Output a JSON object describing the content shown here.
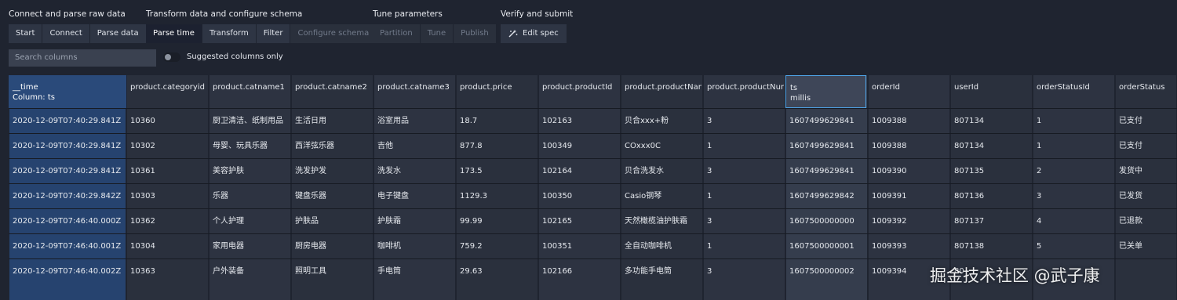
{
  "stages": [
    {
      "title": "Connect and parse raw data",
      "buttons": [
        {
          "label": "Start",
          "state": "normal"
        },
        {
          "label": "Connect",
          "state": "normal"
        },
        {
          "label": "Parse data",
          "state": "normal"
        }
      ]
    },
    {
      "title": "Transform data and configure schema",
      "buttons": [
        {
          "label": "Parse time",
          "state": "active"
        },
        {
          "label": "Transform",
          "state": "normal"
        },
        {
          "label": "Filter",
          "state": "normal"
        },
        {
          "label": "Configure schema",
          "state": "disabled"
        }
      ]
    },
    {
      "title": "Tune parameters",
      "buttons": [
        {
          "label": "Partition",
          "state": "disabled"
        },
        {
          "label": "Tune",
          "state": "disabled"
        },
        {
          "label": "Publish",
          "state": "disabled"
        }
      ]
    },
    {
      "title": "Verify and submit",
      "buttons": [
        {
          "label": "Edit spec",
          "state": "edit",
          "icon": "wand-icon"
        }
      ]
    }
  ],
  "search": {
    "placeholder": "Search columns"
  },
  "toggle": {
    "label": "Suggested columns only",
    "on": false
  },
  "columns": [
    {
      "name": "__time",
      "sub": "Column: ts"
    },
    {
      "name": "product.categoryid"
    },
    {
      "name": "product.catname1"
    },
    {
      "name": "product.catname2"
    },
    {
      "name": "product.catname3"
    },
    {
      "name": "product.price"
    },
    {
      "name": "product.productId"
    },
    {
      "name": "product.productNam"
    },
    {
      "name": "product.productNum"
    },
    {
      "name": "ts",
      "sub": "millis"
    },
    {
      "name": "orderId"
    },
    {
      "name": "userId"
    },
    {
      "name": "orderStatusId"
    },
    {
      "name": "orderStatus"
    }
  ],
  "rows": [
    [
      "2020-12-09T07:40:29.841Z",
      "10360",
      "厨卫清洁、纸制用品",
      "生活日用",
      "浴室用品",
      "18.7",
      "102163",
      "贝合xxx+粉",
      "3",
      "1607499629841",
      "1009388",
      "807134",
      "1",
      "已支付"
    ],
    [
      "2020-12-09T07:40:29.841Z",
      "10302",
      "母婴、玩具乐器",
      "西洋弦乐器",
      "吉他",
      "877.8",
      "100349",
      "COxxx0C",
      "1",
      "1607499629841",
      "1009388",
      "807134",
      "1",
      "已支付"
    ],
    [
      "2020-12-09T07:40:29.841Z",
      "10361",
      "美容护肤",
      "洗发护发",
      "洗发水",
      "173.5",
      "102164",
      "贝合洗发水",
      "3",
      "1607499629841",
      "1009390",
      "807135",
      "2",
      "发货中"
    ],
    [
      "2020-12-09T07:40:29.842Z",
      "10303",
      "乐器",
      "键盘乐器",
      "电子键盘",
      "1129.3",
      "100350",
      "Casio钢琴",
      "1",
      "1607499629842",
      "1009391",
      "807136",
      "3",
      "已发货"
    ],
    [
      "2020-12-09T07:46:40.000Z",
      "10362",
      "个人护理",
      "护肤品",
      "护肤霜",
      "99.99",
      "102165",
      "天然橄榄油护肤霜",
      "3",
      "1607500000000",
      "1009392",
      "807137",
      "4",
      "已退款"
    ],
    [
      "2020-12-09T07:46:40.001Z",
      "10304",
      "家用电器",
      "厨房电器",
      "咖啡机",
      "759.2",
      "100351",
      "全自动咖啡机",
      "1",
      "1607500000001",
      "1009393",
      "807138",
      "5",
      "已关单"
    ],
    [
      "2020-12-09T07:46:40.002Z",
      "10363",
      "户外装备",
      "照明工具",
      "手电筒",
      "29.63",
      "102166",
      "多功能手电筒",
      "3",
      "1607500000002",
      "1009394",
      "80",
      "",
      ""
    ]
  ],
  "watermark": "掘金技术社区 @武子康",
  "colors": {
    "background": "#1f2430",
    "time_column": "#2a4a7a",
    "selected_border": "#4ea3e6"
  }
}
